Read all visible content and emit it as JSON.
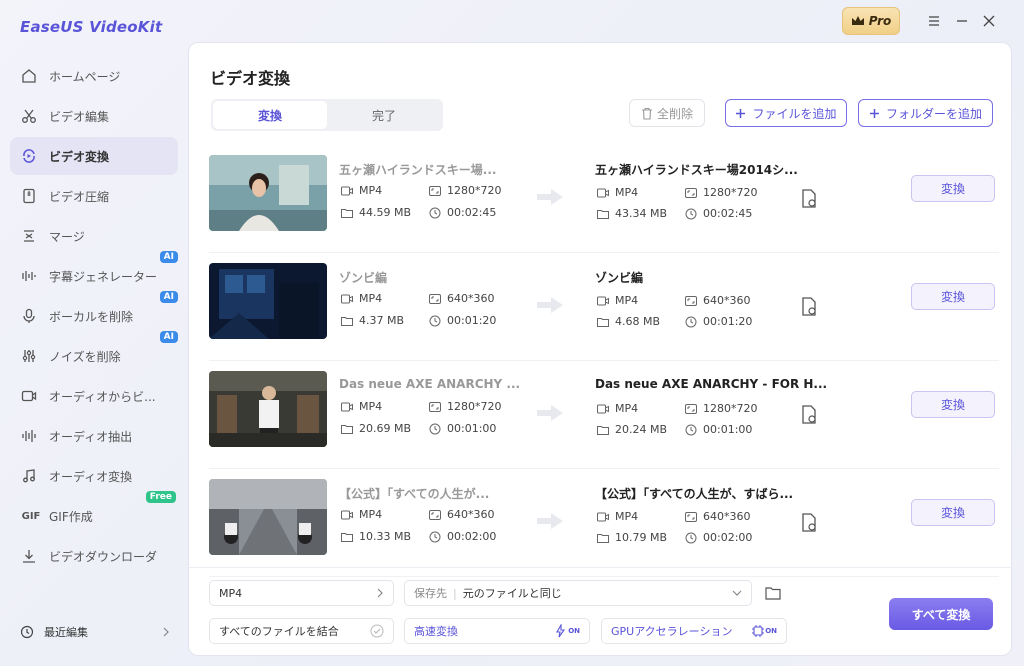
{
  "app": {
    "title": "EaseUS VideoKit",
    "pro_label": "Pro"
  },
  "sidebar": {
    "items": [
      {
        "label": "ホームページ",
        "icon": "home-icon"
      },
      {
        "label": "ビデオ編集",
        "icon": "scissors-icon"
      },
      {
        "label": "ビデオ変換",
        "icon": "convert-icon",
        "active": true
      },
      {
        "label": "ビデオ圧縮",
        "icon": "compress-icon"
      },
      {
        "label": "マージ",
        "icon": "merge-icon"
      },
      {
        "label": "字幕ジェネレーター",
        "icon": "subtitle-icon",
        "badge": "AI"
      },
      {
        "label": "ボーカルを削除",
        "icon": "microphone-icon",
        "badge": "AI"
      },
      {
        "label": "ノイズを削除",
        "icon": "equalizer-icon",
        "badge": "AI"
      },
      {
        "label": "オーディオからビ...",
        "icon": "audio-video-icon"
      },
      {
        "label": "オーディオ抽出",
        "icon": "waveform-icon"
      },
      {
        "label": "オーディオ変換",
        "icon": "music-note-icon"
      },
      {
        "label": "GIF作成",
        "icon": "gif-icon",
        "badge": "Free"
      },
      {
        "label": "ビデオダウンローダ",
        "icon": "download-icon"
      }
    ],
    "recent_label": "最近編集"
  },
  "main": {
    "title": "ビデオ変換",
    "tabs": [
      "変換",
      "完了"
    ],
    "delete_all": "全削除",
    "add_file": "ファイルを追加",
    "add_folder": "フォルダーを追加",
    "convert_label": "変換"
  },
  "files": [
    {
      "src_name": "五ヶ瀬ハイランドスキー場...",
      "src_format": "MP4",
      "src_res": "1280*720",
      "src_size": "44.59 MB",
      "src_dur": "00:02:45",
      "out_name": "五ヶ瀬ハイランドスキー場2014シ...",
      "out_format": "MP4",
      "out_res": "1280*720",
      "out_size": "43.34 MB",
      "out_dur": "00:02:45"
    },
    {
      "src_name": "ゾンビ編",
      "src_format": "MP4",
      "src_res": "640*360",
      "src_size": "4.37 MB",
      "src_dur": "00:01:20",
      "out_name": "ゾンビ編",
      "out_format": "MP4",
      "out_res": "640*360",
      "out_size": "4.68 MB",
      "out_dur": "00:01:20"
    },
    {
      "src_name": "Das neue AXE ANARCHY ...",
      "src_format": "MP4",
      "src_res": "1280*720",
      "src_size": "20.69 MB",
      "src_dur": "00:01:00",
      "out_name": "Das neue AXE ANARCHY - FOR H...",
      "out_format": "MP4",
      "out_res": "1280*720",
      "out_size": "20.24 MB",
      "out_dur": "00:01:00"
    },
    {
      "src_name": "【公式】「すべての人生が...",
      "src_format": "MP4",
      "src_res": "640*360",
      "src_size": "10.33 MB",
      "src_dur": "00:02:00",
      "out_name": "【公式】「すべての人生が、すばら...",
      "out_format": "MP4",
      "out_res": "640*360",
      "out_size": "10.79 MB",
      "out_dur": "00:02:00"
    }
  ],
  "footer": {
    "format": "MP4",
    "save_label": "保存先",
    "save_value": "元のファイルと同じ",
    "merge_label": "すべてのファイルを結合",
    "fast_label": "高速変換",
    "gpu_label": "GPUアクセラレーション",
    "on_label": "ON",
    "convert_all": "すべて変換"
  },
  "colors": {
    "accent": "#5a54d8",
    "badge_ai": "#3b8bea",
    "badge_free": "#2ec48a"
  }
}
